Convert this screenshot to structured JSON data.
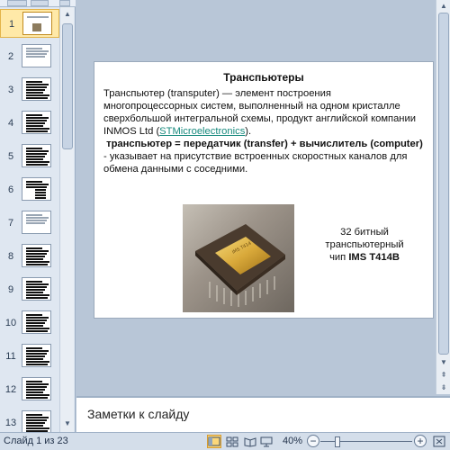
{
  "thumbnails": {
    "selected": "1",
    "items": [
      {
        "number": "1"
      },
      {
        "number": "2"
      },
      {
        "number": "3"
      },
      {
        "number": "4"
      },
      {
        "number": "5"
      },
      {
        "number": "6"
      },
      {
        "number": "7"
      },
      {
        "number": "8"
      },
      {
        "number": "9"
      },
      {
        "number": "10"
      },
      {
        "number": "11"
      },
      {
        "number": "12"
      },
      {
        "number": "13"
      }
    ]
  },
  "slide": {
    "title": "Транспьютеры",
    "para1": "Транспьютер (transputer) — элемент построения многопроцессорных систем, выполненный на одном кристалле сверхбольшой интегральной схемы, продукт английской компании INMOS Ltd (",
    "link": "STMicroelectronics",
    "para1_end": ").",
    "para2_bold": "транспьютер = передатчик (transfer) + вычислитель (computer)",
    "para2_rest": " - указывает на присутствие встроенных скоростных каналов для обмена данными с соседними.",
    "caption_line1": "32 битный",
    "caption_line2": "транспьютерный",
    "caption_line3_prefix": "чип ",
    "caption_line3_bold": "IMS T414B"
  },
  "notes": {
    "placeholder": "Заметки к слайду"
  },
  "status": {
    "slide_counter": "Слайд 1 из 23",
    "zoom": "40%",
    "zoom_level_percent": 40
  },
  "colors": {
    "link": "#17897d",
    "selected_thumb": "#ffe9a8",
    "pane_bg": "#b8c6d7"
  }
}
